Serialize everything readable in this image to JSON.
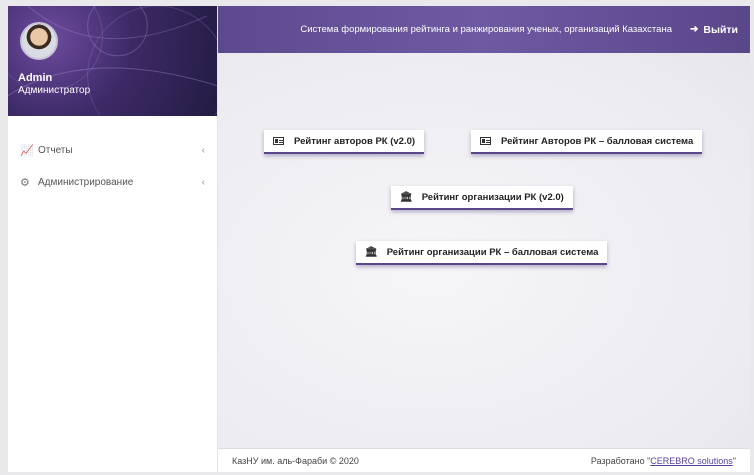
{
  "user": {
    "name": "Admin",
    "role": "Администратор"
  },
  "sidebar": {
    "items": [
      {
        "label": "Отчеты",
        "icon": "chart-line-icon"
      },
      {
        "label": "Администрирование",
        "icon": "gears-icon"
      }
    ]
  },
  "header": {
    "title": "Система формирования рейтинга и ранжирования ученых, организаций Казахстана",
    "logout_label": "Выйти"
  },
  "main": {
    "buttons": [
      {
        "label": "Рейтинг авторов РК (v2.0)",
        "icon": "id-card-icon"
      },
      {
        "label": "Рейтинг Авторов РК – балловая система",
        "icon": "id-card-icon"
      },
      {
        "label": "Рейтинг организации РК (v2.0)",
        "icon": "institution-icon"
      },
      {
        "label": "Рейтинг организации РК – балловая система",
        "icon": "institution-icon"
      }
    ]
  },
  "footer": {
    "left": "КазНУ им. аль-Фараби © 2020",
    "right_prefix": "Разработано \"",
    "right_link": "CEREBRO solutions",
    "right_suffix": "\""
  },
  "colors": {
    "brand": "#5d4a8e",
    "sidebar_bg": "#ffffff",
    "main_bg": "#ececf1"
  }
}
